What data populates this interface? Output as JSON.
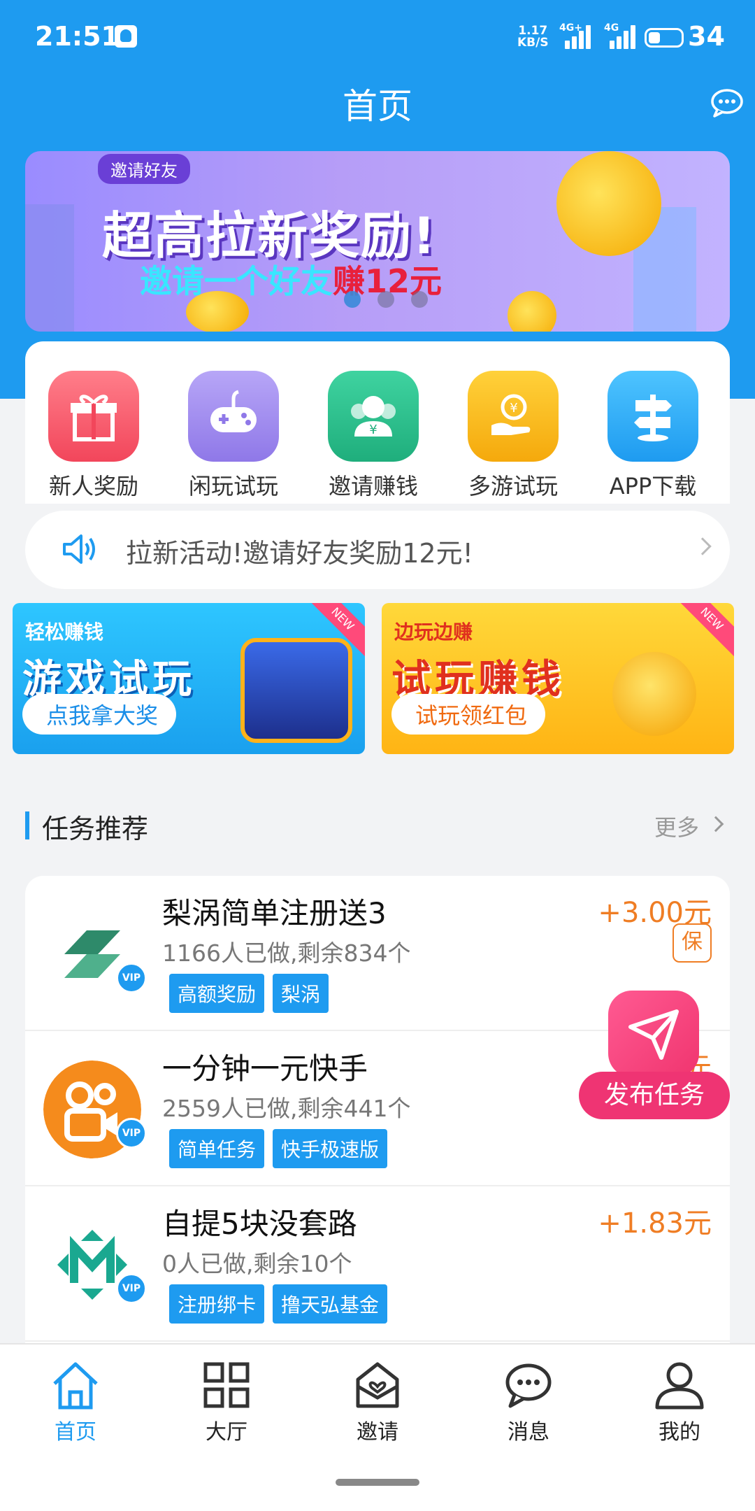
{
  "status_bar": {
    "time": "21:51",
    "net_speed_value": "1.17",
    "net_speed_unit": "KB/S",
    "sim1_label": "4G+",
    "sim2_label": "4G",
    "battery": "34"
  },
  "header": {
    "title": "首页"
  },
  "banner": {
    "tag": "邀请好友",
    "headline": "超高拉新奖励!",
    "sub_text": "邀请一个好友",
    "sub_highlight": "赚12元",
    "page_index": 1,
    "page_count": 3
  },
  "quick_menu": [
    {
      "label": "新人奖励",
      "icon": "gift-icon"
    },
    {
      "label": "闲玩试玩",
      "icon": "gamepad-icon"
    },
    {
      "label": "邀请赚钱",
      "icon": "invite-users-icon"
    },
    {
      "label": "多游试玩",
      "icon": "coin-hand-icon"
    },
    {
      "label": "APP下载",
      "icon": "signpost-icon"
    }
  ],
  "notice": {
    "text": "拉新活动!邀请好友奖励12元!"
  },
  "promos": [
    {
      "small": "轻松赚钱",
      "big": "游戏试玩",
      "button": "点我拿大奖",
      "badge": "NEW"
    },
    {
      "small": "边玩边赚",
      "big": "试玩赚钱",
      "button": "试玩领红包",
      "badge": "NEW"
    }
  ],
  "section": {
    "title": "任务推荐",
    "more": "更多"
  },
  "tasks": [
    {
      "name": "梨涡简单注册送3",
      "stats": "1166人已做,剩余834个",
      "tags": [
        "高额奖励",
        "梨涡"
      ],
      "price": "+3.00元",
      "badge": "保"
    },
    {
      "name": "一分钟一元快手",
      "stats": "2559人已做,剩余441个",
      "tags": [
        "简单任务",
        "快手极速版"
      ],
      "price": "元"
    },
    {
      "name": "自提5块没套路",
      "stats": "0人已做,剩余10个",
      "tags": [
        "注册绑卡",
        "撸天弘基金"
      ],
      "price": "+1.83元"
    }
  ],
  "vip_label": "VIP",
  "fab": {
    "label": "发布任务"
  },
  "bottom_nav": [
    {
      "label": "首页",
      "icon": "home-icon",
      "active": true
    },
    {
      "label": "大厅",
      "icon": "grid-icon"
    },
    {
      "label": "邀请",
      "icon": "heart-mail-icon"
    },
    {
      "label": "消息",
      "icon": "chat-icon"
    },
    {
      "label": "我的",
      "icon": "user-icon"
    }
  ],
  "colors": {
    "primary": "#1e9bf0",
    "price": "#ef7d24",
    "fab": "#ef3473"
  }
}
